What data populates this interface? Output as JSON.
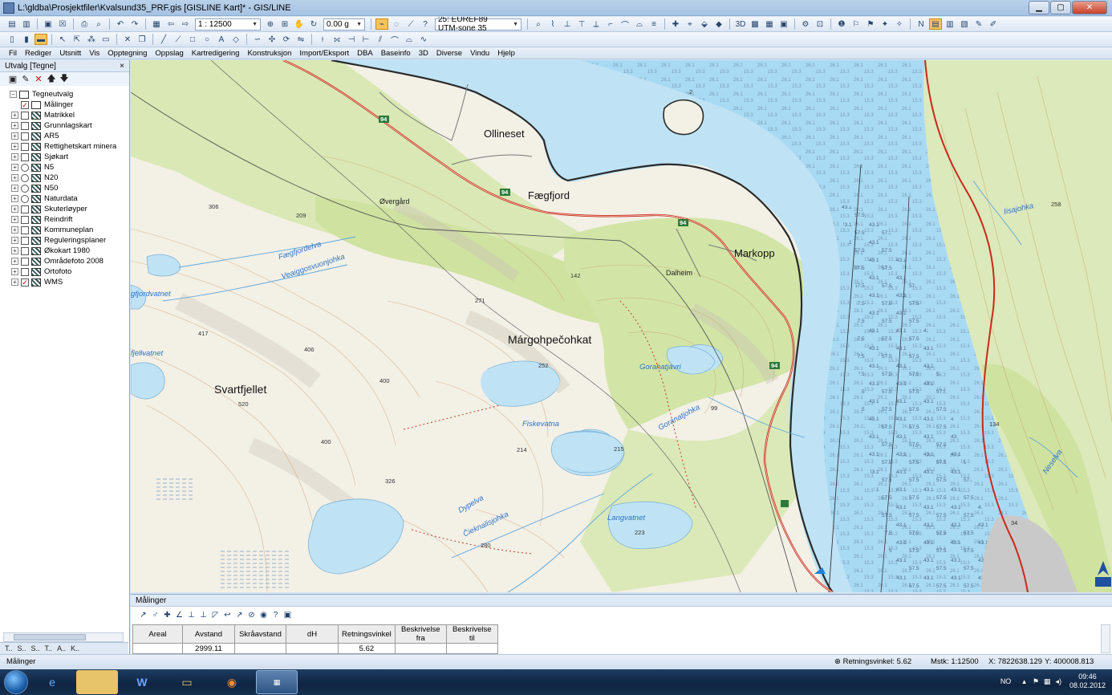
{
  "window": {
    "title": "L:\\gldba\\Prosjektfiler\\Kvalsund35_PRF.gis [GISLINE Kart]* - GIS/LINE",
    "buttons": [
      "minimize",
      "maximize",
      "close"
    ]
  },
  "toolbar": {
    "scale": "1 : 12500",
    "angle": "0.00 g",
    "projection": "25: EUREF89 UTM-sone 35"
  },
  "menu": [
    "Fil",
    "Rediger",
    "Utsnitt",
    "Vis",
    "Opptegning",
    "Oppslag",
    "Kartredigering",
    "Konstruksjon",
    "Import/Eksport",
    "DBA",
    "Baseinfo",
    "3D",
    "Diverse",
    "Vindu",
    "Hjelp"
  ],
  "left_panel": {
    "title": "Utvalg [Tegne]",
    "close": "×",
    "root": "Tegneutvalg",
    "items": [
      {
        "label": "Målinger",
        "checked": true,
        "type": "check"
      },
      {
        "label": "Matrikkel",
        "checked": false,
        "type": "check"
      },
      {
        "label": "Grunnlagskart",
        "checked": false,
        "type": "check"
      },
      {
        "label": "AR5",
        "checked": false,
        "type": "check"
      },
      {
        "label": "Rettighetskart minera",
        "checked": false,
        "type": "check"
      },
      {
        "label": "Sjøkart",
        "checked": false,
        "type": "check"
      },
      {
        "label": "N5",
        "checked": false,
        "type": "radio"
      },
      {
        "label": "N20",
        "checked": false,
        "type": "radio"
      },
      {
        "label": "N50",
        "checked": false,
        "type": "radio"
      },
      {
        "label": "Naturdata",
        "checked": false,
        "type": "radio"
      },
      {
        "label": "Skuterløyper",
        "checked": false,
        "type": "check"
      },
      {
        "label": "Reindrift",
        "checked": false,
        "type": "check"
      },
      {
        "label": "Kommuneplan",
        "checked": false,
        "type": "check"
      },
      {
        "label": "Reguleringsplaner",
        "checked": false,
        "type": "check"
      },
      {
        "label": "Økokart 1980",
        "checked": false,
        "type": "check"
      },
      {
        "label": "Områdefoto 2008",
        "checked": false,
        "type": "check"
      },
      {
        "label": "Ortofoto",
        "checked": false,
        "type": "check"
      },
      {
        "label": "WMS",
        "checked": true,
        "type": "check"
      }
    ],
    "tabs": [
      "T..",
      "S..",
      "S..",
      "T..",
      "A..",
      "K.."
    ]
  },
  "map": {
    "places": [
      "Ollineset",
      "Fægfjord",
      "Øvergård",
      "Markopp",
      "Dalheim",
      "Márgohpečohkat",
      "Svartfjellet"
    ],
    "waters": [
      "Fægfjordelva",
      "Veaiggosvuonjohka",
      "gfjordvatnet",
      "fjellvatnet",
      "Gorahatjávri",
      "Goranatjohka",
      "Fiskevatna",
      "Dypelva",
      "Čieknalisjohka",
      "Langvatnet",
      "Iisajohka",
      "Neselva"
    ],
    "heights": [
      "306",
      "209",
      "142",
      "271",
      "417",
      "406",
      "400",
      "520",
      "400",
      "252",
      "214",
      "215",
      "326",
      "280",
      "223",
      "99",
      "258",
      "134",
      "34",
      "2"
    ],
    "roads": [
      "94",
      "94",
      "94",
      "94"
    ]
  },
  "measurements": {
    "title": "Målinger",
    "columns": [
      "Areal",
      "Avstand",
      "Skråavstand",
      "dH",
      "Retningsvinkel",
      "Beskrivelse fra",
      "Beskrivelse til"
    ],
    "rows": [
      [
        "",
        "2999.11",
        "",
        "",
        "5.62",
        "",
        ""
      ]
    ]
  },
  "status": {
    "left": "Målinger",
    "direction": "Retningsvinkel: 5.62",
    "scale": "Mstk: 1:12500",
    "x": "X: 7822638.129",
    "y": "Y: 400008.813"
  },
  "taskbar": {
    "lang": "NO",
    "time": "09:46",
    "date": "08.02.2012"
  }
}
